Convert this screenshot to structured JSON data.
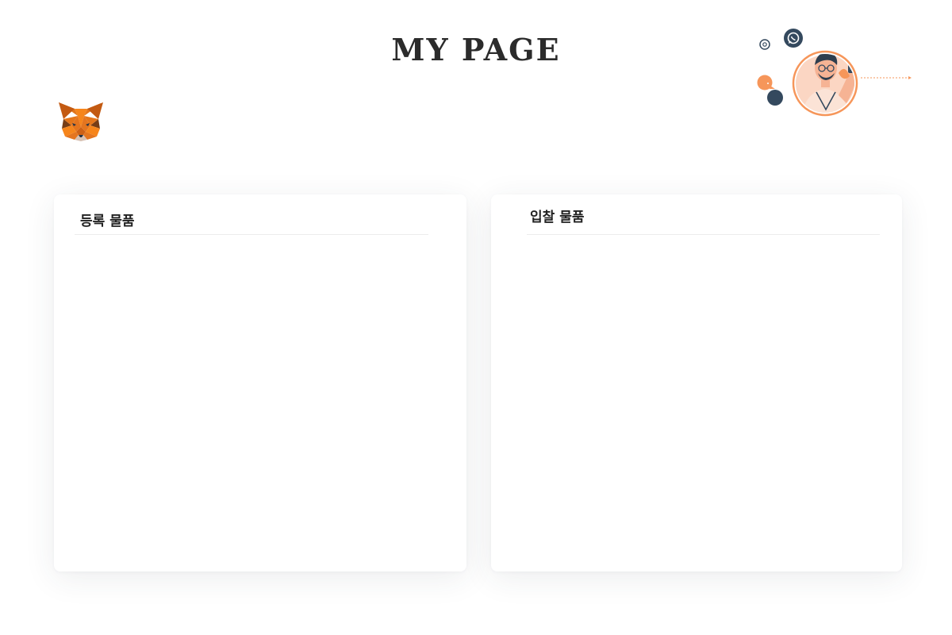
{
  "header": {
    "title": "MY PAGE"
  },
  "icons": {
    "logo": "metamask-fox-icon",
    "illustration": "person-with-phone-illustration",
    "whatsapp": "whatsapp-icon",
    "email": "at-sign-icon"
  },
  "colors": {
    "fox_orange": "#E2761B",
    "accent_orange": "#F6965A",
    "slate": "#34495E"
  },
  "panels": {
    "registered": {
      "title": "등록 물품",
      "items": []
    },
    "bids": {
      "title": "입찰 물품",
      "items": []
    }
  }
}
